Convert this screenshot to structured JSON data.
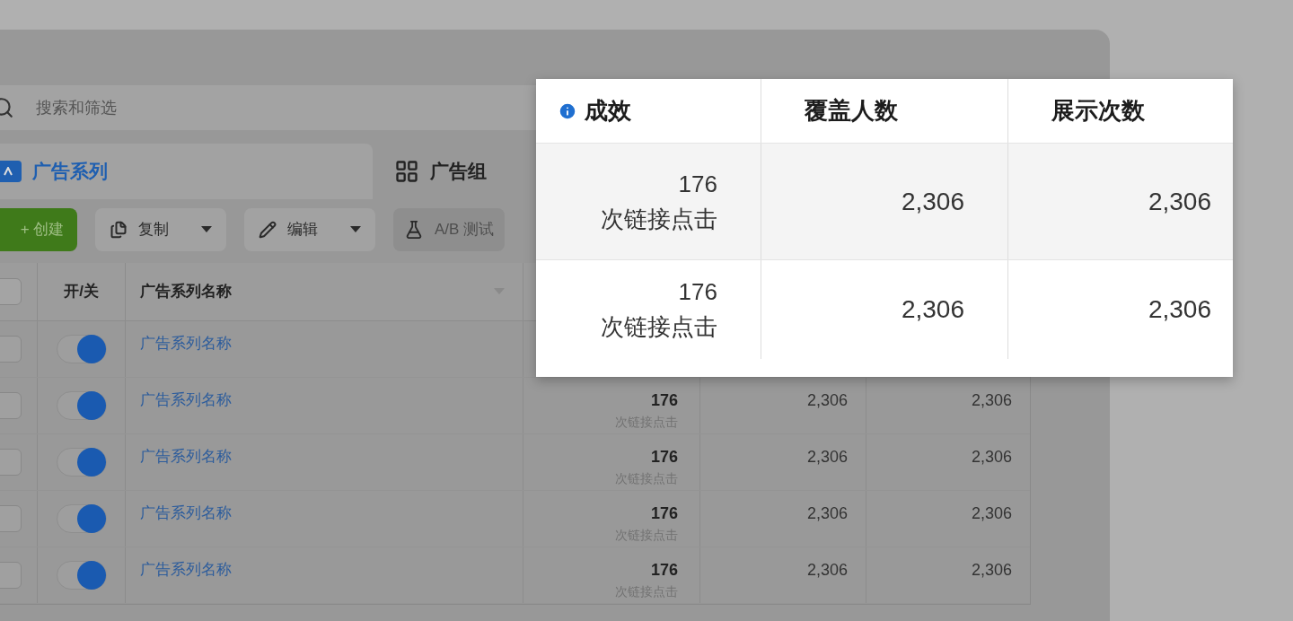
{
  "search": {
    "placeholder": "搜索和筛选"
  },
  "tabs": [
    {
      "label": "广告系列",
      "selected": true
    },
    {
      "label": "广告组",
      "selected": false
    }
  ],
  "toolbar": [
    {
      "kind": "create",
      "label": "+ 创建",
      "disabled": false
    },
    {
      "kind": "copy",
      "label": "复制",
      "disabled": false
    },
    {
      "kind": "edit",
      "label": "编辑",
      "disabled": false
    },
    {
      "kind": "test",
      "label": "A/B 测试",
      "disabled": true
    }
  ],
  "table": {
    "select_all_checked": false,
    "columns": [
      "开/关",
      "广告系列名称"
    ],
    "rows": [
      {
        "checked": false,
        "on": true,
        "name": "广告系列名称"
      },
      {
        "checked": false,
        "on": true,
        "name": "广告系列名称",
        "results": "176",
        "results_unit": "次链接点击",
        "reach": "2,306",
        "impressions": "2,306"
      },
      {
        "checked": false,
        "on": true,
        "name": "广告系列名称",
        "results": "176",
        "results_unit": "次链接点击",
        "reach": "2,306",
        "impressions": "2,306"
      },
      {
        "checked": false,
        "on": true,
        "name": "广告系列名称",
        "results": "176",
        "results_unit": "次链接点击",
        "reach": "2,306",
        "impressions": "2,306"
      },
      {
        "checked": false,
        "on": true,
        "name": "广告系列名称",
        "results": "176",
        "results_unit": "次链接点击",
        "reach": "2,306",
        "impressions": "2,306"
      }
    ]
  },
  "popup": {
    "columns": [
      "成效",
      "覆盖人数",
      "展示次数"
    ],
    "rows": [
      {
        "results": "176",
        "results_unit": "次链接点击",
        "reach": "2,306",
        "impressions": "2,306"
      },
      {
        "results": "176",
        "results_unit": "次链接点击",
        "reach": "2,306",
        "impressions": "2,306"
      }
    ]
  }
}
